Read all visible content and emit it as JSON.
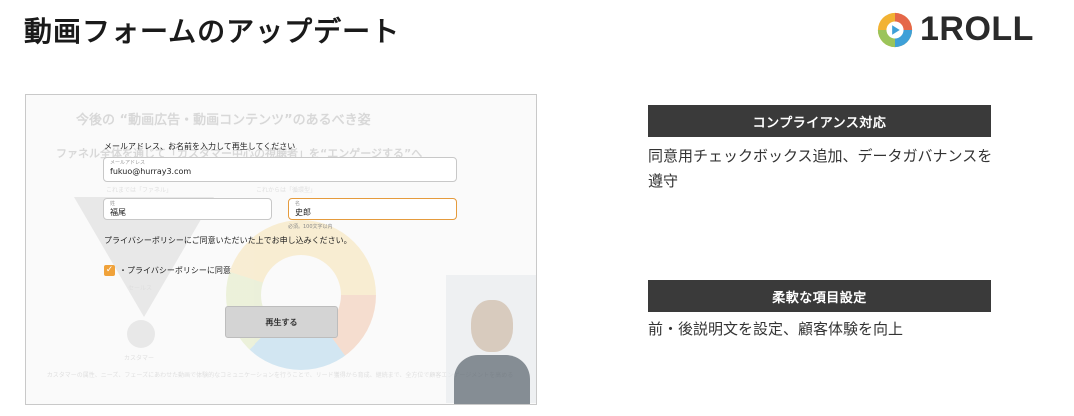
{
  "header": {
    "title": "動画フォームのアップデート",
    "logo_text": "1ROLL"
  },
  "screenshot": {
    "background": {
      "heading": "今後の “動画広告・動画コンテンツ”のあるべき姿",
      "subheading": "ファネル全体を通じて「カスタマー中心の視聴者」を“エンゲージする”へ",
      "label_left_top": "これまでは「ファネル」",
      "label_right_top": "これからは「循環型」",
      "label_sales": "セールス",
      "label_customer": "カスタマー",
      "footer": "カスタマーの属性、ニーズ、フェーズにあわせた動画で体験的なコミュニケーションを行うことで、リード獲得から育成、継続まで、全方位で顧客エンゲージメントを高める"
    },
    "form": {
      "prompt": "メールアドレス、お名前を入力して再生してください",
      "email": {
        "caption": "メールアドレス",
        "value": "fukuo@hurray3.com"
      },
      "last_name": {
        "caption": "姓",
        "value": "福尾"
      },
      "first_name": {
        "caption": "名",
        "value": "史郎"
      },
      "first_name_hint": "必須。100文字以内",
      "policy_text": "プライバシーポリシーにご同意いただいた上でお申し込みください。",
      "checkbox_label": "・プライバシーポリシーに同意",
      "play_button": "再生する"
    }
  },
  "features": [
    {
      "title": "コンプライアンス対応",
      "description": "同意用チェックボックス追加、データガバナンスを遵守"
    },
    {
      "title": "柔軟な項目設定",
      "description": "前・後説明文を設定、顧客体験を向上"
    }
  ],
  "colors": {
    "feature_header_bg": "#3a3a3a",
    "accent_orange": "#f0a23a"
  }
}
